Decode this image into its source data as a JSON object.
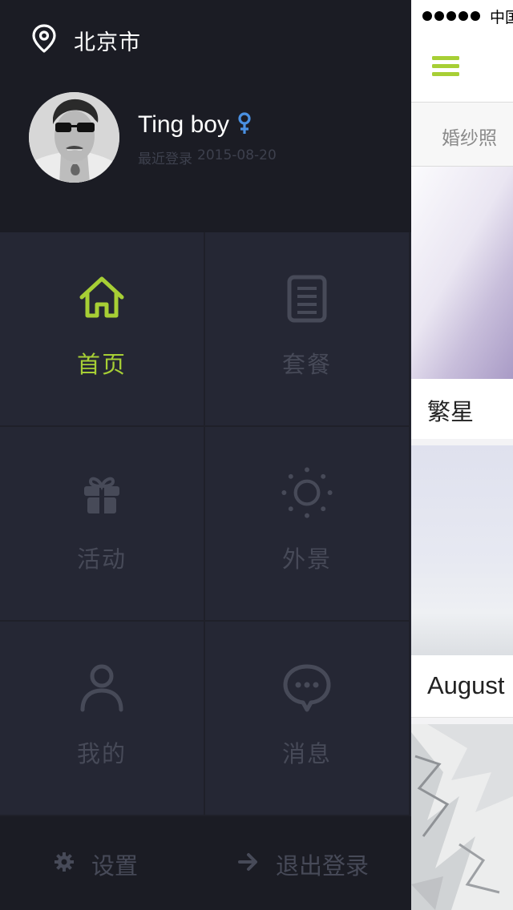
{
  "drawer": {
    "location": {
      "city": "北京市",
      "icon": "location-pin-icon"
    },
    "user": {
      "name": "Ting boy",
      "gender_icon": "female-symbol-icon",
      "last_login_label": "最近登录",
      "last_login_date": "2015-08-20"
    },
    "menu": [
      {
        "label": "首页",
        "icon": "home-icon",
        "active": true
      },
      {
        "label": "套餐",
        "icon": "document-icon",
        "active": false
      },
      {
        "label": "活动",
        "icon": "gift-icon",
        "active": false
      },
      {
        "label": "外景",
        "icon": "sun-icon",
        "active": false
      },
      {
        "label": "我的",
        "icon": "person-icon",
        "active": false
      },
      {
        "label": "消息",
        "icon": "chat-bubble-icon",
        "active": false
      }
    ],
    "bottom": {
      "settings_label": "设置",
      "logout_label": "退出登录"
    }
  },
  "main": {
    "status_bar": {
      "carrier": "中国"
    },
    "tab_label": "婚纱照",
    "cards": [
      {
        "title": "繁星"
      },
      {
        "title": "August"
      },
      {
        "title": ""
      }
    ]
  },
  "colors": {
    "accent": "#a7cf35",
    "drawer_bg": "#252734",
    "drawer_header_bg": "#1b1c24",
    "inactive": "#474a58",
    "gender": "#4a90e2"
  }
}
